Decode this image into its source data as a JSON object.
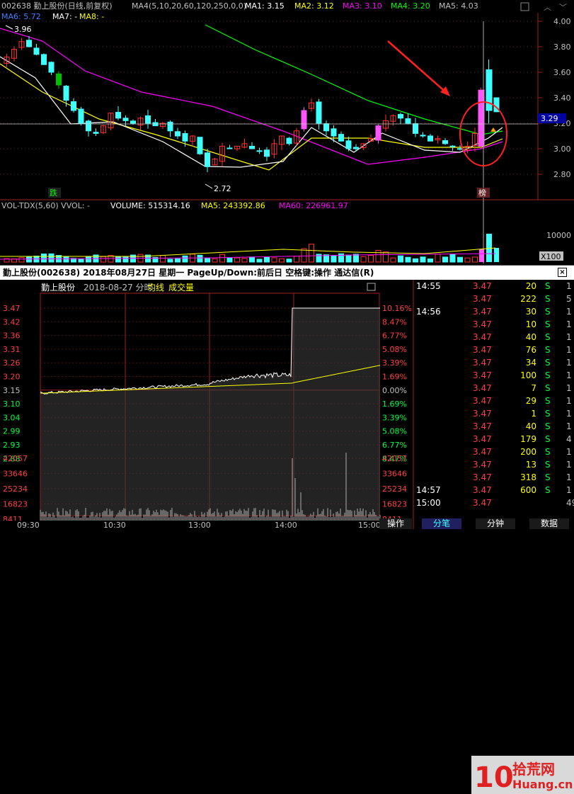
{
  "kline": {
    "header": {
      "stock_label": "002638 勤上股份(日线,前复权)",
      "ma4_label": "MA4(5,10,20,60,120,250,0,0)",
      "ma1": "MA1: 3.15",
      "ma2": "MA2: 3.12",
      "ma3": "MA3: 3.10",
      "ma4": "MA4: 3.20",
      "ma5": "MA5: 4.03",
      "ma6": "MA6: 5.72",
      "ma7": "MA7: -",
      "ma8": "MA8: -"
    },
    "price_axis": [
      "4.00",
      "3.80",
      "3.60",
      "3.40",
      "3.20",
      "3.00",
      "2.80"
    ],
    "current_price_tag": "3.29",
    "high_annotation": "3.96",
    "low_annotation": "2.72",
    "marker_left": "跌",
    "marker_right": "榜",
    "volume_header": {
      "title": "VOL-TDX(5,60) VVOL: -",
      "volume": "VOLUME: 515314.16",
      "ma5": "MA5: 243392.86",
      "ma60": "MA60: 226961.97"
    },
    "volume_axis_top": "10000",
    "volume_axis_unit": "X100",
    "colors": {
      "up": "#ff3030",
      "down": "#40ffff",
      "ma1": "#ffffff",
      "ma2": "#ffff00",
      "ma3": "#ff00ff",
      "ma4": "#00ff00",
      "limit_up": "#ff55ff"
    }
  },
  "intraday": {
    "window_title": "勤上股份(002638) 2018年08月27日 星期一 PageUp/Down:前后日 空格键:操作 通达信(R)",
    "subtitle_name": "勤上股份",
    "subtitle_date": "2018-08-27 分时",
    "subtitle_avg": "均线",
    "subtitle_vol": "成交量",
    "price_labels": [
      "3.47",
      "3.42",
      "3.36",
      "3.31",
      "3.26",
      "3.20",
      "3.15",
      "3.10",
      "3.04",
      "2.99",
      "2.93",
      "2.88"
    ],
    "pct_labels": [
      "10.16%",
      "8.47%",
      "6.77%",
      "5.08%",
      "3.39%",
      "1.69%",
      "0.00%",
      "1.69%",
      "3.39%",
      "5.08%",
      "6.77%",
      "8.47%"
    ],
    "vol_labels": [
      "42057",
      "33646",
      "25234",
      "16823",
      "8411"
    ],
    "time_labels": [
      "09:30",
      "10:30",
      "13:00",
      "14:00",
      "15:00"
    ]
  },
  "ticks": {
    "rows": [
      {
        "time": "14:55",
        "price": "3.47",
        "vol": "20",
        "side": "S",
        "extra": "1"
      },
      {
        "time": "",
        "price": "3.47",
        "vol": "222",
        "side": "S",
        "extra": "5"
      },
      {
        "time": "14:56",
        "price": "3.47",
        "vol": "30",
        "side": "S",
        "extra": "1"
      },
      {
        "time": "",
        "price": "3.47",
        "vol": "10",
        "side": "S",
        "extra": "1"
      },
      {
        "time": "",
        "price": "3.47",
        "vol": "40",
        "side": "S",
        "extra": "1"
      },
      {
        "time": "",
        "price": "3.47",
        "vol": "76",
        "side": "S",
        "extra": "1"
      },
      {
        "time": "",
        "price": "3.47",
        "vol": "34",
        "side": "S",
        "extra": "1"
      },
      {
        "time": "",
        "price": "3.47",
        "vol": "100",
        "side": "S",
        "extra": "1"
      },
      {
        "time": "",
        "price": "3.47",
        "vol": "7",
        "side": "S",
        "extra": "1"
      },
      {
        "time": "",
        "price": "3.47",
        "vol": "29",
        "side": "S",
        "extra": "1"
      },
      {
        "time": "",
        "price": "3.47",
        "vol": "1",
        "side": "S",
        "extra": "1"
      },
      {
        "time": "",
        "price": "3.47",
        "vol": "40",
        "side": "S",
        "extra": "1"
      },
      {
        "time": "",
        "price": "3.47",
        "vol": "179",
        "side": "S",
        "extra": "4"
      },
      {
        "time": "",
        "price": "3.47",
        "vol": "200",
        "side": "S",
        "extra": "1"
      },
      {
        "time": "",
        "price": "3.47",
        "vol": "13",
        "side": "S",
        "extra": "1"
      },
      {
        "time": "",
        "price": "3.47",
        "vol": "318",
        "side": "S",
        "extra": "1"
      },
      {
        "time": "14:57",
        "price": "3.47",
        "vol": "600",
        "side": "S",
        "extra": "1"
      },
      {
        "time": "15:00",
        "price": "3.47",
        "vol": "",
        "side": "",
        "extra": "49"
      }
    ]
  },
  "tabs": [
    "操作",
    "分笔",
    "分钟",
    "数据"
  ],
  "watermark": {
    "number": "10",
    "brand": "拾荒网",
    "domain": "Huang.cn"
  }
}
